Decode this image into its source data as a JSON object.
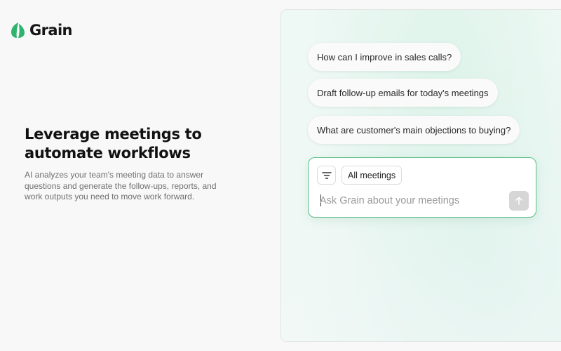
{
  "brand": {
    "name": "Grain",
    "logo_color": "#2fb36e"
  },
  "hero": {
    "title": "Leverage meetings to\nautomate workflows",
    "description": "AI analyzes your team's meeting data to answer questions and generate the follow-ups, reports, and work outputs you need to move work forward."
  },
  "suggestions": [
    "How can I improve in sales calls?",
    "Draft follow-up emails for today's meetings",
    "What are customer's main objections to buying?"
  ],
  "composer": {
    "filter_icon": "filter-icon",
    "scope_label": "All meetings",
    "input_value": "",
    "placeholder": "Ask Grain about your meetings",
    "send_icon": "arrow-up-icon",
    "accent": "#5cc08a"
  }
}
